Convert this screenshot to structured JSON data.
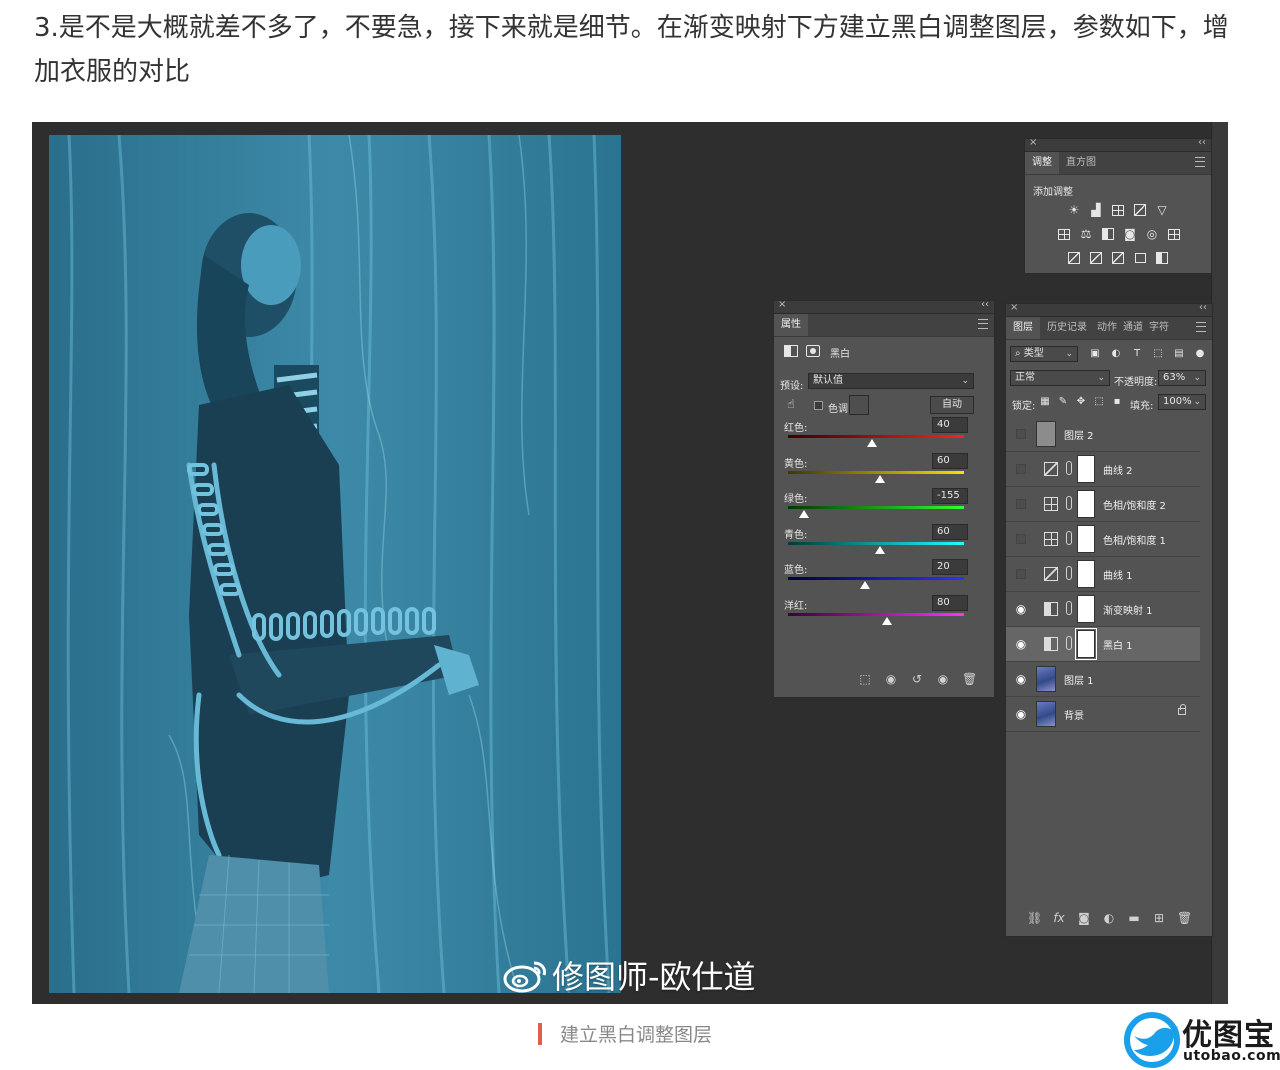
{
  "article": {
    "paragraph": "3.是不是大概就差不多了，不要急，接下来就是细节。在渐变映射下方建立黑白调整图层，参数如下，增加衣服的对比"
  },
  "photo": {
    "watermark": "修图师-欧仕道"
  },
  "adjustments_panel": {
    "tabs": [
      "调整",
      "直方图"
    ],
    "section_title": "添加调整"
  },
  "properties_panel": {
    "tab": "属性",
    "adjustment_name": "黑白",
    "preset_label": "预设:",
    "preset_value": "默认值",
    "tint_label": "色调",
    "auto_button": "自动",
    "sliders": [
      {
        "label": "红色:",
        "value": 40,
        "min": -200,
        "max": 300,
        "colors": [
          "#3a0000",
          "#ff2020"
        ]
      },
      {
        "label": "黄色:",
        "value": 60,
        "min": -200,
        "max": 300,
        "colors": [
          "#3a3a00",
          "#ffe000"
        ]
      },
      {
        "label": "绿色:",
        "value": -155,
        "min": -200,
        "max": 300,
        "colors": [
          "#003a00",
          "#30ff30"
        ]
      },
      {
        "label": "青色:",
        "value": 60,
        "min": -200,
        "max": 300,
        "colors": [
          "#003a3a",
          "#20ffff"
        ]
      },
      {
        "label": "蓝色:",
        "value": 20,
        "min": -200,
        "max": 300,
        "colors": [
          "#00003a",
          "#3030ff"
        ]
      },
      {
        "label": "洋红:",
        "value": 80,
        "min": -200,
        "max": 300,
        "colors": [
          "#3a003a",
          "#ff30ff"
        ]
      }
    ]
  },
  "layers_panel": {
    "tabs": [
      "图层",
      "历史记录",
      "动作",
      "通道",
      "字符"
    ],
    "filter_kind": "类型",
    "blend_mode": "正常",
    "opacity_label": "不透明度:",
    "opacity_value": "63%",
    "lock_label": "锁定:",
    "fill_label": "填充:",
    "fill_value": "100%",
    "layers": [
      {
        "name": "图层 2",
        "visible": false,
        "kind": "pixel-gray",
        "selected": false
      },
      {
        "name": "曲线 2",
        "visible": false,
        "kind": "curves",
        "selected": false
      },
      {
        "name": "色相/饱和度 2",
        "visible": false,
        "kind": "hue-sat",
        "selected": false
      },
      {
        "name": "色相/饱和度 1",
        "visible": false,
        "kind": "hue-sat",
        "selected": false
      },
      {
        "name": "曲线 1",
        "visible": false,
        "kind": "curves",
        "selected": false
      },
      {
        "name": "渐变映射 1",
        "visible": true,
        "kind": "gradient-map",
        "selected": false
      },
      {
        "name": "黑白 1",
        "visible": true,
        "kind": "black-white",
        "selected": true
      },
      {
        "name": "图层 1",
        "visible": true,
        "kind": "image",
        "selected": false
      },
      {
        "name": "背景",
        "visible": true,
        "kind": "image",
        "selected": false,
        "locked": true
      }
    ]
  },
  "caption": {
    "text": "建立黑白调整图层"
  },
  "logo": {
    "name": "优图宝",
    "domain": "utobao.com"
  }
}
